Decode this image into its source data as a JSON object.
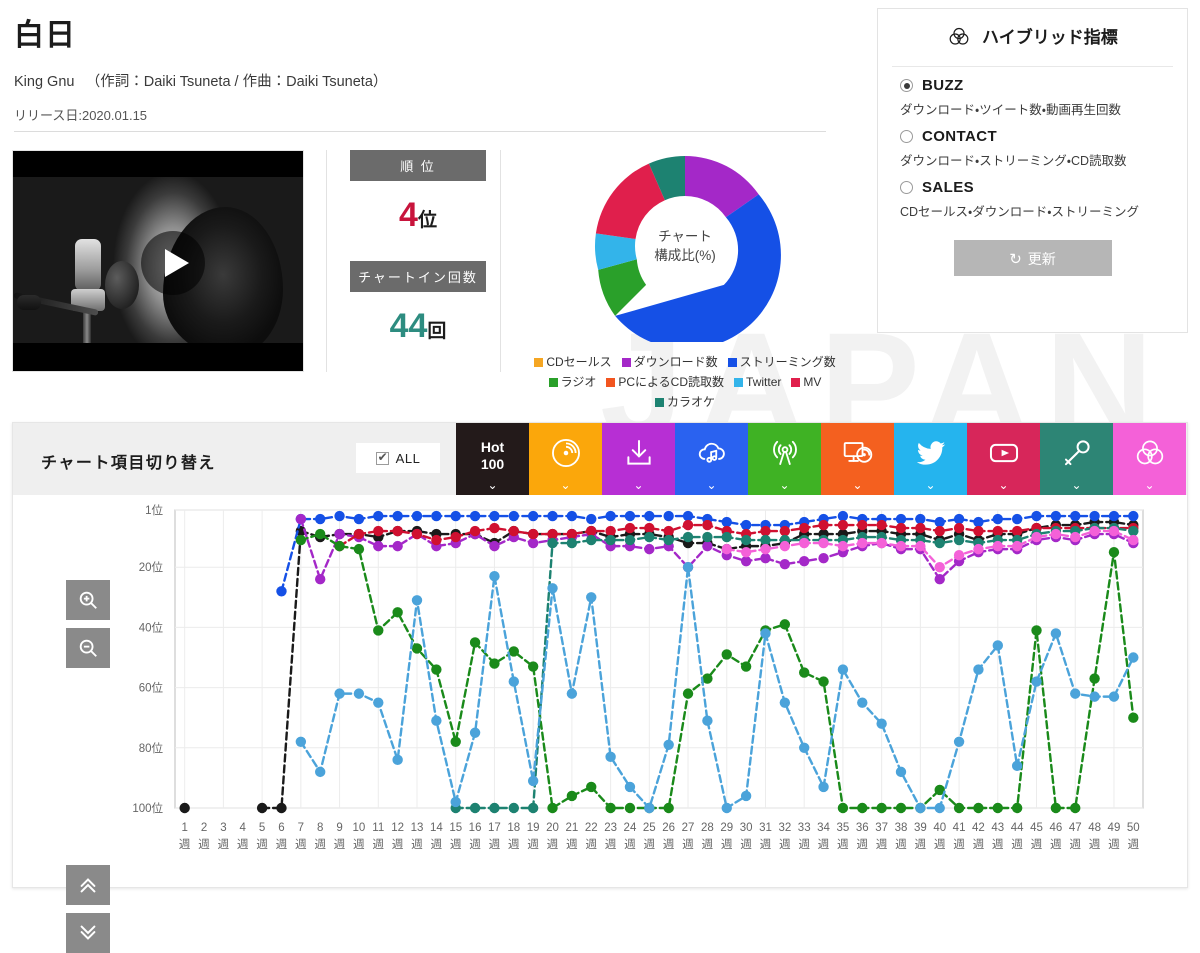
{
  "watermark": "JAPAN",
  "song": {
    "title": "白日",
    "credit": "King Gnu 　（作詞：Daiki Tsuneta / 作曲：Daiki Tsuneta）",
    "release": "リリース日:2020.01.15"
  },
  "video": {
    "play_icon": "play-icon"
  },
  "stats": {
    "rank_label": "順 位",
    "rank_value": "4",
    "rank_unit": "位",
    "rank_color": "#c8143c",
    "chartin_label": "チャートイン回数",
    "chartin_value": "44",
    "chartin_unit": "回",
    "chartin_color": "#2d8c80"
  },
  "donut": {
    "center_line1": "チャート",
    "center_line2": "構成比(%)",
    "legend": [
      {
        "label": "CDセールス",
        "color": "#f5a623"
      },
      {
        "label": "ダウンロード数",
        "color": "#a428c8"
      },
      {
        "label": "ストリーミング数",
        "color": "#1550e6"
      },
      {
        "label": "ラジオ",
        "color": "#2aa02a"
      },
      {
        "label": "PCによるCD読取数",
        "color": "#f2551f"
      },
      {
        "label": "Twitter",
        "color": "#33b4ea"
      },
      {
        "label": "MV",
        "color": "#e01f4c"
      },
      {
        "label": "カラオケ",
        "color": "#1d8271"
      }
    ]
  },
  "hybrid": {
    "icon": "venn-icon",
    "title": "ハイブリッド指標",
    "options": [
      {
        "name": "BUZZ",
        "desc": "ダウンロード・ツイート数・動画再生回数",
        "selected": true
      },
      {
        "name": "CONTACT",
        "desc": "ダウンロード・ストリーミング・CD読取数",
        "selected": false
      },
      {
        "name": "SALES",
        "desc": "CDセールス・ダウンロード・ストリーミング",
        "selected": false
      }
    ],
    "update_label": "更新",
    "update_icon": "refresh-icon"
  },
  "chart_toolbar": {
    "title": "チャート項目切り替え",
    "all_label": "ALL",
    "all_checked": true,
    "tabs": [
      {
        "name": "hot100",
        "label_line1": "Hot",
        "label_line2": "100",
        "icon": "text-hot100",
        "color": "#231a1a",
        "active": true
      },
      {
        "name": "cd-sales",
        "icon": "vinyl-icon",
        "color": "#fba70b",
        "active": false
      },
      {
        "name": "download",
        "icon": "download-icon",
        "color": "#b72fd4",
        "active": false
      },
      {
        "name": "streaming",
        "icon": "cloud-note-icon",
        "color": "#2a62f0",
        "active": false
      },
      {
        "name": "radio",
        "icon": "broadcast-icon",
        "color": "#3fb224",
        "active": false
      },
      {
        "name": "pc-cd",
        "icon": "monitor-disc-icon",
        "color": "#f4601f",
        "active": false
      },
      {
        "name": "twitter",
        "icon": "twitter-icon",
        "color": "#25b4ee",
        "active": false
      },
      {
        "name": "mv",
        "icon": "youtube-icon",
        "color": "#d7265a",
        "active": false
      },
      {
        "name": "karaoke",
        "icon": "microphone-icon",
        "color": "#2d8575",
        "active": false
      },
      {
        "name": "hybrid",
        "icon": "venn-icon",
        "color": "#f461d8",
        "active": false
      }
    ],
    "zoom_in_icon": "zoom-in-icon",
    "zoom_out_icon": "zoom-out-icon",
    "scroll_up_icon": "chevron-double-up-icon",
    "scroll_down_icon": "chevron-double-down-icon"
  },
  "chart_data": {
    "type": "line",
    "title": "",
    "xlabel": "",
    "ylabel": "",
    "y_inverted": true,
    "ylim": [
      1,
      100
    ],
    "y_ticks": [
      1,
      20,
      40,
      60,
      80,
      100
    ],
    "y_tick_labels": [
      "1位",
      "20位",
      "40位",
      "60位",
      "80位",
      "100位"
    ],
    "x": [
      1,
      2,
      3,
      4,
      5,
      6,
      7,
      8,
      9,
      10,
      11,
      12,
      13,
      14,
      15,
      16,
      17,
      18,
      19,
      20,
      21,
      22,
      23,
      24,
      25,
      26,
      27,
      28,
      29,
      30,
      31,
      32,
      33,
      34,
      35,
      36,
      37,
      38,
      39,
      40,
      41,
      42,
      43,
      44,
      45,
      46,
      47,
      48,
      49,
      50
    ],
    "categories": [
      "1週",
      "2週",
      "3週",
      "4週",
      "5週",
      "6週",
      "7週",
      "8週",
      "9週",
      "10週",
      "11週",
      "12週",
      "13週",
      "14週",
      "15週",
      "16週",
      "17週",
      "18週",
      "19週",
      "20週",
      "21週",
      "22週",
      "23週",
      "24週",
      "25週",
      "26週",
      "27週",
      "28週",
      "29週",
      "30週",
      "31週",
      "32週",
      "33週",
      "34週",
      "35週",
      "36週",
      "37週",
      "38週",
      "39週",
      "40週",
      "41週",
      "42週",
      "43週",
      "44週",
      "45週",
      "46週",
      "47週",
      "48週",
      "49週",
      "50週"
    ],
    "grid": true,
    "legend_position": "none",
    "series": [
      {
        "name": "Hot 100",
        "color": "#1a1a1a",
        "values": [
          100,
          null,
          null,
          null,
          100,
          100,
          8,
          10,
          9,
          9,
          10,
          8,
          8,
          9,
          9,
          9,
          12,
          8,
          9,
          9,
          9,
          8,
          10,
          9,
          9,
          10,
          12,
          12,
          14,
          13,
          13,
          12,
          9,
          9,
          9,
          8,
          8,
          9,
          9,
          11,
          9,
          11,
          9,
          9,
          7,
          6,
          6,
          5,
          5,
          6
        ]
      },
      {
        "name": "ストリーミング数",
        "color": "#1550e6",
        "values": [
          null,
          null,
          null,
          null,
          null,
          28,
          4,
          4,
          3,
          4,
          3,
          3,
          3,
          3,
          3,
          3,
          3,
          3,
          3,
          3,
          3,
          4,
          3,
          3,
          3,
          3,
          3,
          4,
          5,
          6,
          6,
          6,
          5,
          4,
          3,
          4,
          4,
          4,
          4,
          5,
          4,
          5,
          4,
          4,
          3,
          3,
          3,
          3,
          3,
          3
        ]
      },
      {
        "name": "ダウンロード数",
        "color": "#a428c8",
        "values": [
          null,
          null,
          null,
          null,
          null,
          null,
          4,
          24,
          9,
          10,
          13,
          13,
          9,
          13,
          12,
          9,
          13,
          10,
          12,
          11,
          10,
          9,
          13,
          13,
          14,
          13,
          20,
          13,
          16,
          18,
          17,
          19,
          18,
          17,
          15,
          13,
          12,
          14,
          14,
          24,
          18,
          15,
          14,
          14,
          11,
          10,
          11,
          9,
          9,
          12
        ]
      },
      {
        "name": "MV",
        "color": "#d01030",
        "values": [
          null,
          null,
          null,
          null,
          null,
          null,
          null,
          null,
          13,
          9,
          8,
          8,
          9,
          11,
          10,
          8,
          7,
          8,
          9,
          9,
          9,
          8,
          8,
          7,
          7,
          8,
          6,
          6,
          8,
          9,
          8,
          8,
          7,
          6,
          6,
          6,
          6,
          7,
          7,
          8,
          7,
          8,
          8,
          8,
          7,
          7,
          7,
          7,
          7,
          7
        ]
      },
      {
        "name": "カラオケ",
        "color": "#1d8271",
        "values": [
          null,
          null,
          null,
          null,
          null,
          null,
          null,
          null,
          null,
          null,
          null,
          null,
          null,
          null,
          100,
          100,
          100,
          100,
          100,
          12,
          12,
          11,
          11,
          11,
          10,
          11,
          10,
          10,
          10,
          11,
          11,
          11,
          11,
          11,
          11,
          10,
          10,
          11,
          11,
          12,
          11,
          12,
          11,
          11,
          9,
          8,
          8,
          7,
          7,
          8
        ]
      },
      {
        "name": "ハイブリッド",
        "color": "#f461d8",
        "values": [
          null,
          null,
          null,
          null,
          null,
          null,
          null,
          null,
          null,
          null,
          null,
          null,
          null,
          null,
          null,
          null,
          null,
          null,
          null,
          null,
          null,
          null,
          null,
          null,
          null,
          null,
          null,
          null,
          14,
          15,
          14,
          13,
          12,
          12,
          13,
          12,
          12,
          13,
          13,
          20,
          16,
          14,
          13,
          13,
          10,
          9,
          10,
          8,
          8,
          11
        ]
      },
      {
        "name": "ラジオ",
        "color": "#1a8a1a",
        "values": [
          null,
          null,
          null,
          null,
          null,
          null,
          11,
          9,
          13,
          14,
          41,
          35,
          47,
          54,
          78,
          45,
          52,
          48,
          53,
          100,
          96,
          93,
          100,
          100,
          100,
          100,
          62,
          57,
          49,
          53,
          41,
          39,
          55,
          58,
          100,
          100,
          100,
          100,
          100,
          94,
          100,
          100,
          100,
          100,
          41,
          100,
          100,
          57,
          15,
          70
        ]
      },
      {
        "name": "Twitter",
        "color": "#4ba3da",
        "values": [
          null,
          null,
          null,
          null,
          null,
          null,
          78,
          88,
          62,
          62,
          65,
          84,
          31,
          71,
          98,
          75,
          23,
          58,
          91,
          27,
          62,
          30,
          83,
          93,
          100,
          79,
          20,
          71,
          100,
          96,
          42,
          65,
          80,
          93,
          54,
          65,
          72,
          88,
          100,
          100,
          78,
          54,
          46,
          86,
          58,
          42,
          62,
          63,
          63,
          50
        ]
      }
    ]
  }
}
